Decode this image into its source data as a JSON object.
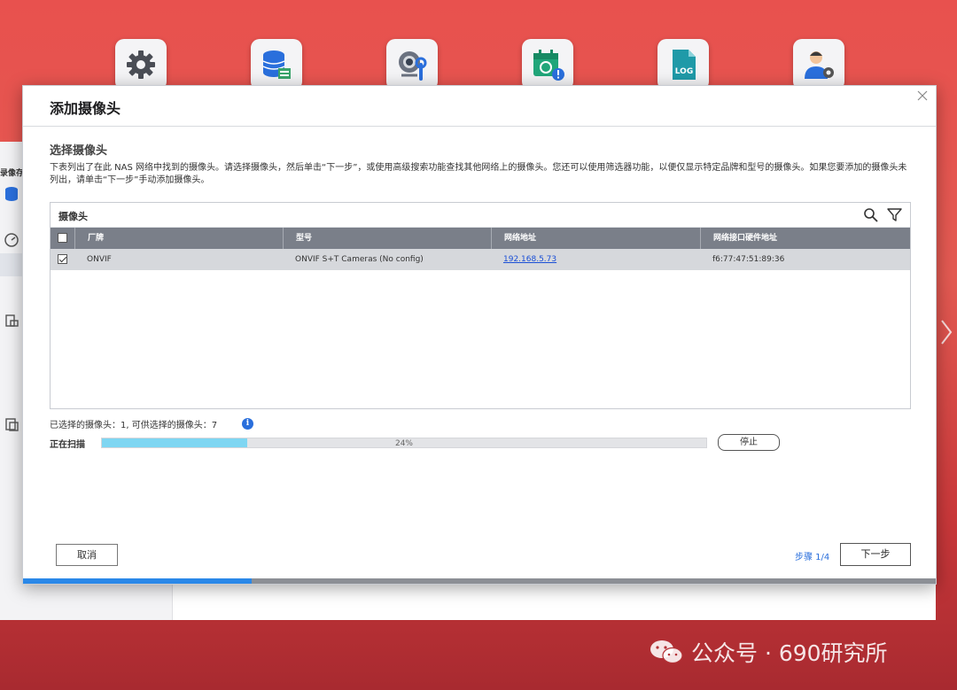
{
  "dock": {
    "icons": [
      "settings-gear-icon",
      "storage-database-icon",
      "camera-tools-icon",
      "calendar-schedule-icon",
      "log-file-icon",
      "user-settings-icon"
    ],
    "log_label": "LOG"
  },
  "background_app": {
    "title_fragment": "录像存"
  },
  "modal": {
    "title": "添加摄像头",
    "section_title": "选择摄像头",
    "description": "下表列出了在此 NAS 网络中找到的摄像头。请选择摄像头，然后单击“下一步”，或使用高级搜索功能查找其他网络上的摄像头。您还可以使用筛选器功能，以便仅显示特定品牌和型号的摄像头。如果您要添加的摄像头未列出，请单击“下一步”手动添加摄像头。",
    "table": {
      "caption": "摄像头",
      "columns": [
        "厂牌",
        "型号",
        "网络地址",
        "网络接口硬件地址"
      ],
      "select_all_checked": false,
      "rows": [
        {
          "checked": true,
          "brand": "ONVIF",
          "model": "ONVIF S+T Cameras (No config)",
          "ip": "192.168.5.73",
          "mac": "f6:77:47:51:89:36"
        }
      ]
    },
    "selected_count_text": "已选择的摄像头：1, 可供选择的摄像头：7",
    "scan": {
      "label": "正在扫描",
      "percent": 24,
      "percent_text": "24%",
      "stop_label": "停止"
    },
    "footer": {
      "cancel_label": "取消",
      "step_text": "步骤 1/4",
      "next_label": "下一步",
      "wizard_progress": 0.25
    }
  },
  "watermark": {
    "text": "公众号 · 690研究所"
  },
  "colors": {
    "accent": "#2a6fdc",
    "progress_fill": "#7fd6f2",
    "table_header": "#7a7f89",
    "selected_row": "#d6d8dc"
  }
}
